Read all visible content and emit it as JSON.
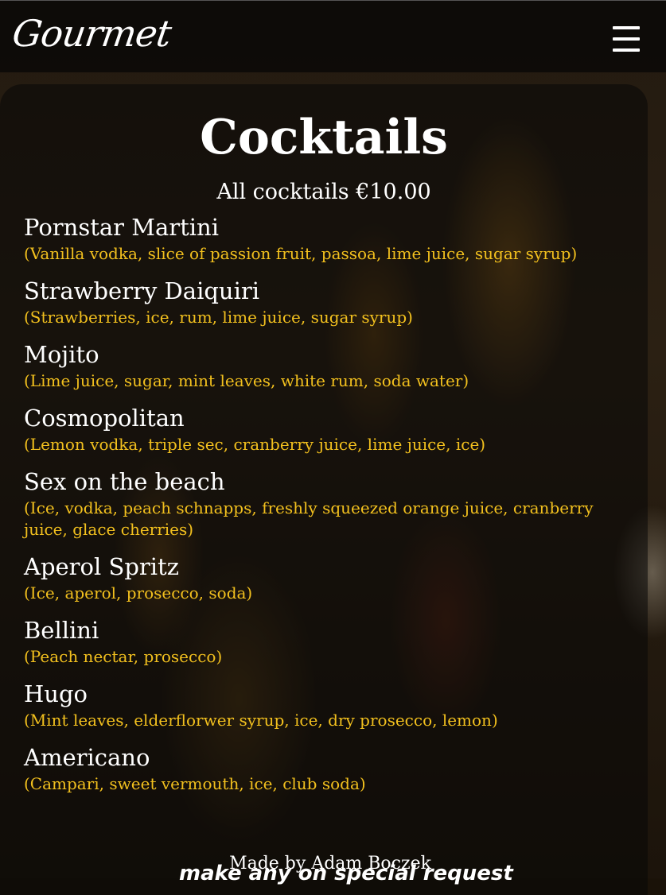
{
  "navbar": {
    "logo": "Gourmet",
    "menu_icon": "hamburger-menu-icon"
  },
  "menu": {
    "title": "Cocktails",
    "subtitle": "All cocktails €10.00",
    "items": [
      {
        "name": "Pornstar Martini",
        "desc": "(Vanilla vodka, slice of passion fruit, passoa, lime juice, sugar syrup)"
      },
      {
        "name": "Strawberry Daiquiri",
        "desc": "(Strawberries, ice, rum, lime juice, sugar syrup)"
      },
      {
        "name": "Mojito",
        "desc": "(Lime juice, sugar, mint leaves, white rum, soda water)"
      },
      {
        "name": "Cosmopolitan",
        "desc": "(Lemon vodka, triple sec, cranberry juice, lime juice, ice)"
      },
      {
        "name": "Sex on the beach",
        "desc": "(Ice, vodka, peach schnapps, freshly squeezed orange juice, cranberry juice, glace cherries)"
      },
      {
        "name": "Aperol Spritz",
        "desc": "(Ice, aperol, prosecco, soda)"
      },
      {
        "name": "Bellini",
        "desc": "(Peach nectar, prosecco)"
      },
      {
        "name": "Hugo",
        "desc": "(Mint leaves, elderflorwer syrup, ice, dry prosecco, lemon)"
      },
      {
        "name": "Americano",
        "desc": "(Campari, sweet vermouth, ice, club soda)"
      }
    ]
  },
  "footer": {
    "credit": "Made by Adam Boczek",
    "note": "make any on special request"
  },
  "colors": {
    "accent": "#f2c01e",
    "text": "#ffffff"
  }
}
